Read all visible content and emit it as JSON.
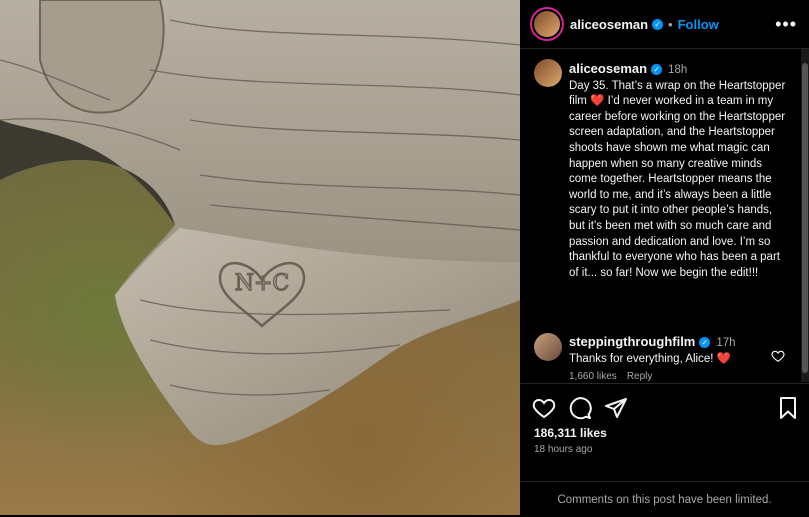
{
  "post": {
    "username": "aliceoseman",
    "follow_label": "Follow",
    "more_label": "•••",
    "separator": "•"
  },
  "caption": {
    "username": "aliceoseman",
    "time": "18h",
    "text": "Day 35. That’s a wrap on the Heartstopper film ❤️  I’d never worked in a team in my career before working on the Heartstopper screen adaptation, and the Heartstopper shoots have shown me what magic can happen when so many creative minds come together. Heartstopper means the world to me, and it’s always been a little scary to put it into other people’s hands, but it’s been met with so much care and passion and dedication and love. I’m so thankful to everyone who has been a part of it... so far! Now we begin the edit!!!"
  },
  "comments": [
    {
      "username": "steppingthroughfilm",
      "time": "17h",
      "text": "Thanks for everything, Alice! ❤️",
      "likes": "1,660 likes",
      "reply": "Reply"
    }
  ],
  "engagement": {
    "likes": "186,311 likes",
    "time_ago": "18 hours ago",
    "comments_limited": "Comments on this post have been limited."
  },
  "photo": {
    "carving_text": "N+C"
  },
  "colors": {
    "accent": "#0095f6",
    "background": "#000000",
    "secondary_text": "#a8a8a8"
  },
  "icons": {
    "like": "heart-icon",
    "comment": "comment-icon",
    "share": "share-icon",
    "save": "bookmark-icon",
    "verified": "verified-badge-icon"
  }
}
